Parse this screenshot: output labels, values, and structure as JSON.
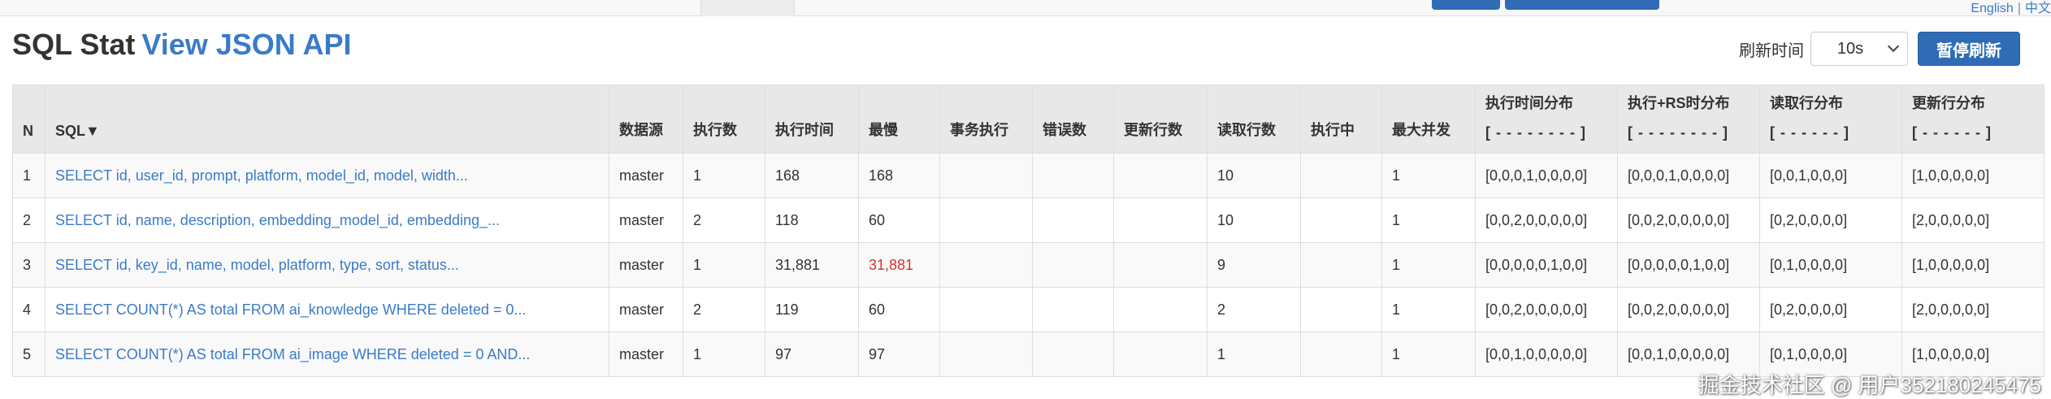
{
  "nav": {
    "lang_en": "English",
    "lang_sep": "|",
    "lang_zh": "中文"
  },
  "header": {
    "title": "SQL Stat",
    "json_link": "View JSON API"
  },
  "refresh": {
    "label": "刷新时间",
    "interval": "10s",
    "pause_label": "暂停刷新"
  },
  "table": {
    "headers": {
      "n": "N",
      "sql": "SQL▼",
      "datasource": "数据源",
      "exec_count": "执行数",
      "exec_time": "执行时间",
      "slowest": "最慢",
      "txn_exec": "事务执行",
      "error_count": "错误数",
      "update_rows": "更新行数",
      "read_rows": "读取行数",
      "running": "执行中",
      "max_concurrent": "最大并发",
      "exec_hist": "执行时间分布",
      "exec_hist_sub": "[ - - - - - - - - ]",
      "exec_rs_hist": "执行+RS时分布",
      "exec_rs_hist_sub": "[ - - - - - - - - ]",
      "read_hist": "读取行分布",
      "read_hist_sub": "[ - - - - - - ]",
      "update_hist": "更新行分布",
      "update_hist_sub": "[ - - - - - - ]"
    },
    "rows": [
      {
        "n": "1",
        "sql": "SELECT id, user_id, prompt, platform, model_id, model, width...",
        "datasource": "master",
        "exec_count": "1",
        "exec_time": "168",
        "slowest": "168",
        "txn_exec": "",
        "error_count": "",
        "update_rows": "",
        "read_rows": "10",
        "running": "",
        "max_concurrent": "1",
        "exec_hist": "[0,0,0,1,0,0,0,0]",
        "exec_rs_hist": "[0,0,0,1,0,0,0,0]",
        "read_hist": "[0,0,1,0,0,0]",
        "update_hist": "[1,0,0,0,0,0]"
      },
      {
        "n": "2",
        "sql": "SELECT id, name, description, embedding_model_id, embedding_...",
        "datasource": "master",
        "exec_count": "2",
        "exec_time": "118",
        "slowest": "60",
        "txn_exec": "",
        "error_count": "",
        "update_rows": "",
        "read_rows": "10",
        "running": "",
        "max_concurrent": "1",
        "exec_hist": "[0,0,2,0,0,0,0,0]",
        "exec_rs_hist": "[0,0,2,0,0,0,0,0]",
        "read_hist": "[0,2,0,0,0,0]",
        "update_hist": "[2,0,0,0,0,0]"
      },
      {
        "n": "3",
        "sql": "SELECT id, key_id, name, model, platform, type, sort, status...",
        "datasource": "master",
        "exec_count": "1",
        "exec_time": "31,881",
        "slowest": "31,881",
        "txn_exec": "",
        "error_count": "",
        "update_rows": "",
        "read_rows": "9",
        "running": "",
        "max_concurrent": "1",
        "exec_hist": "[0,0,0,0,0,1,0,0]",
        "exec_rs_hist": "[0,0,0,0,0,1,0,0]",
        "read_hist": "[0,1,0,0,0,0]",
        "update_hist": "[1,0,0,0,0,0]"
      },
      {
        "n": "4",
        "sql": "SELECT COUNT(*) AS total FROM ai_knowledge WHERE deleted = 0...",
        "datasource": "master",
        "exec_count": "2",
        "exec_time": "119",
        "slowest": "60",
        "txn_exec": "",
        "error_count": "",
        "update_rows": "",
        "read_rows": "2",
        "running": "",
        "max_concurrent": "1",
        "exec_hist": "[0,0,2,0,0,0,0,0]",
        "exec_rs_hist": "[0,0,2,0,0,0,0,0]",
        "read_hist": "[0,2,0,0,0,0]",
        "update_hist": "[2,0,0,0,0,0]"
      },
      {
        "n": "5",
        "sql": "SELECT COUNT(*) AS total FROM ai_image WHERE deleted = 0 AND...",
        "datasource": "master",
        "exec_count": "1",
        "exec_time": "97",
        "slowest": "97",
        "txn_exec": "",
        "error_count": "",
        "update_rows": "",
        "read_rows": "1",
        "running": "",
        "max_concurrent": "1",
        "exec_hist": "[0,0,1,0,0,0,0,0]",
        "exec_rs_hist": "[0,0,1,0,0,0,0,0]",
        "read_hist": "[0,1,0,0,0,0]",
        "update_hist": "[1,0,0,0,0,0]"
      }
    ]
  },
  "watermark": "掘金技术社区 @ 用户352180245475",
  "colors": {
    "link": "#3a7bc8",
    "button": "#2f6cb5",
    "slow_highlight": "#d9342b"
  }
}
